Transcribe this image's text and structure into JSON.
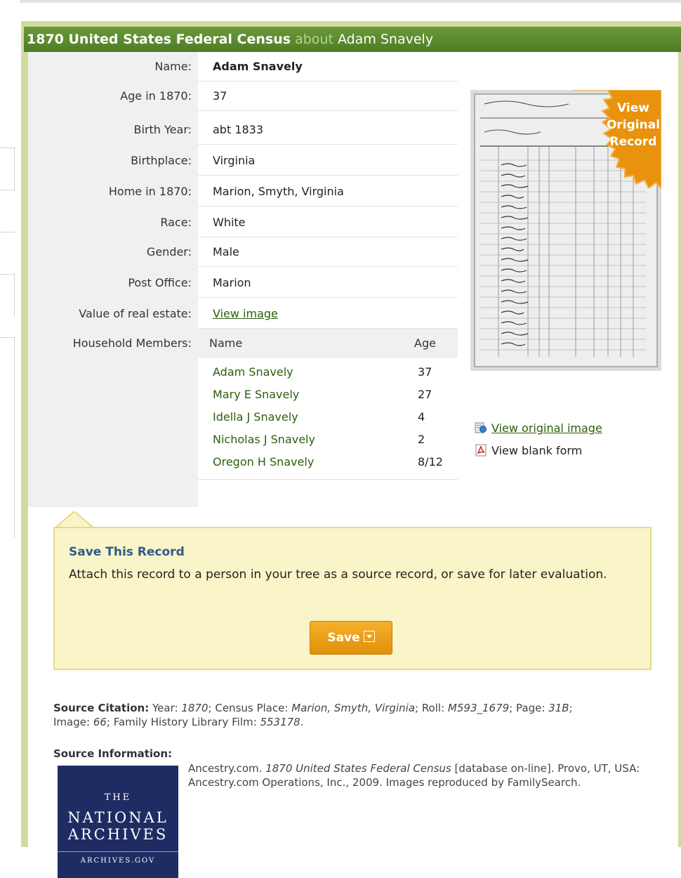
{
  "record": {
    "title": "1870 United States Federal Census",
    "about": "about",
    "person": "Adam Snavely"
  },
  "fields": [
    {
      "label": "Name:",
      "value": "Adam Snavely"
    },
    {
      "label": "Age in 1870:",
      "value": "37"
    },
    {
      "label": "Birth Year:",
      "value": "abt 1833"
    },
    {
      "label": "Birthplace:",
      "value": "Virginia"
    },
    {
      "label": "Home in 1870:",
      "value": "Marion, Smyth, Virginia"
    },
    {
      "label": "Race:",
      "value": "White"
    },
    {
      "label": "Gender:",
      "value": "Male"
    },
    {
      "label": "Post Office:",
      "value": "Marion"
    },
    {
      "label": "Value of real estate:",
      "value": "View image"
    }
  ],
  "household": {
    "label": "Household Members:",
    "col_name": "Name",
    "col_age": "Age",
    "members": [
      {
        "name": "Adam Snavely",
        "age": "37"
      },
      {
        "name": "Mary E Snavely",
        "age": "27"
      },
      {
        "name": "Idella J Snavely",
        "age": "4"
      },
      {
        "name": "Nicholas J Snavely",
        "age": "2"
      },
      {
        "name": "Oregon H Snavely",
        "age": "8/12"
      }
    ]
  },
  "badge": {
    "line1": "View",
    "line2": "Original",
    "line3": "Record"
  },
  "side_links": {
    "view_original": "View original image",
    "view_blank": "View blank form"
  },
  "save": {
    "title": "Save This Record",
    "description": "Attach this record to a person in your tree as a source record, or save for later evaluation.",
    "button": "Save"
  },
  "citation": {
    "heading": "Source Citation:",
    "year_label": "Year:",
    "year": "1870",
    "place_label": "Census Place:",
    "place": "Marion, Smyth, Virginia",
    "roll_label": "Roll:",
    "roll": "M593_1679",
    "page_label": "Page:",
    "page": "31B",
    "image_label": "Image:",
    "image": "66",
    "fhl_label": "Family History Library Film:",
    "film": "553178"
  },
  "source_info": {
    "heading": "Source Information:",
    "pre": "Ancestry.com.",
    "title": "1870 United States Federal Census",
    "post": "[database on-line]. Provo, UT, USA: Ancestry.com Operations, Inc., 2009. Images reproduced by FamilySearch."
  },
  "archives_logo": {
    "the": "THE",
    "line1": "NATIONAL",
    "line2": "ARCHIVES",
    "url": "ARCHIVES.GOV"
  },
  "colors": {
    "title_bg": "#4e7c25",
    "link": "#2a5f0c",
    "save_bg": "#e0900a",
    "badge": "#e8920e"
  }
}
